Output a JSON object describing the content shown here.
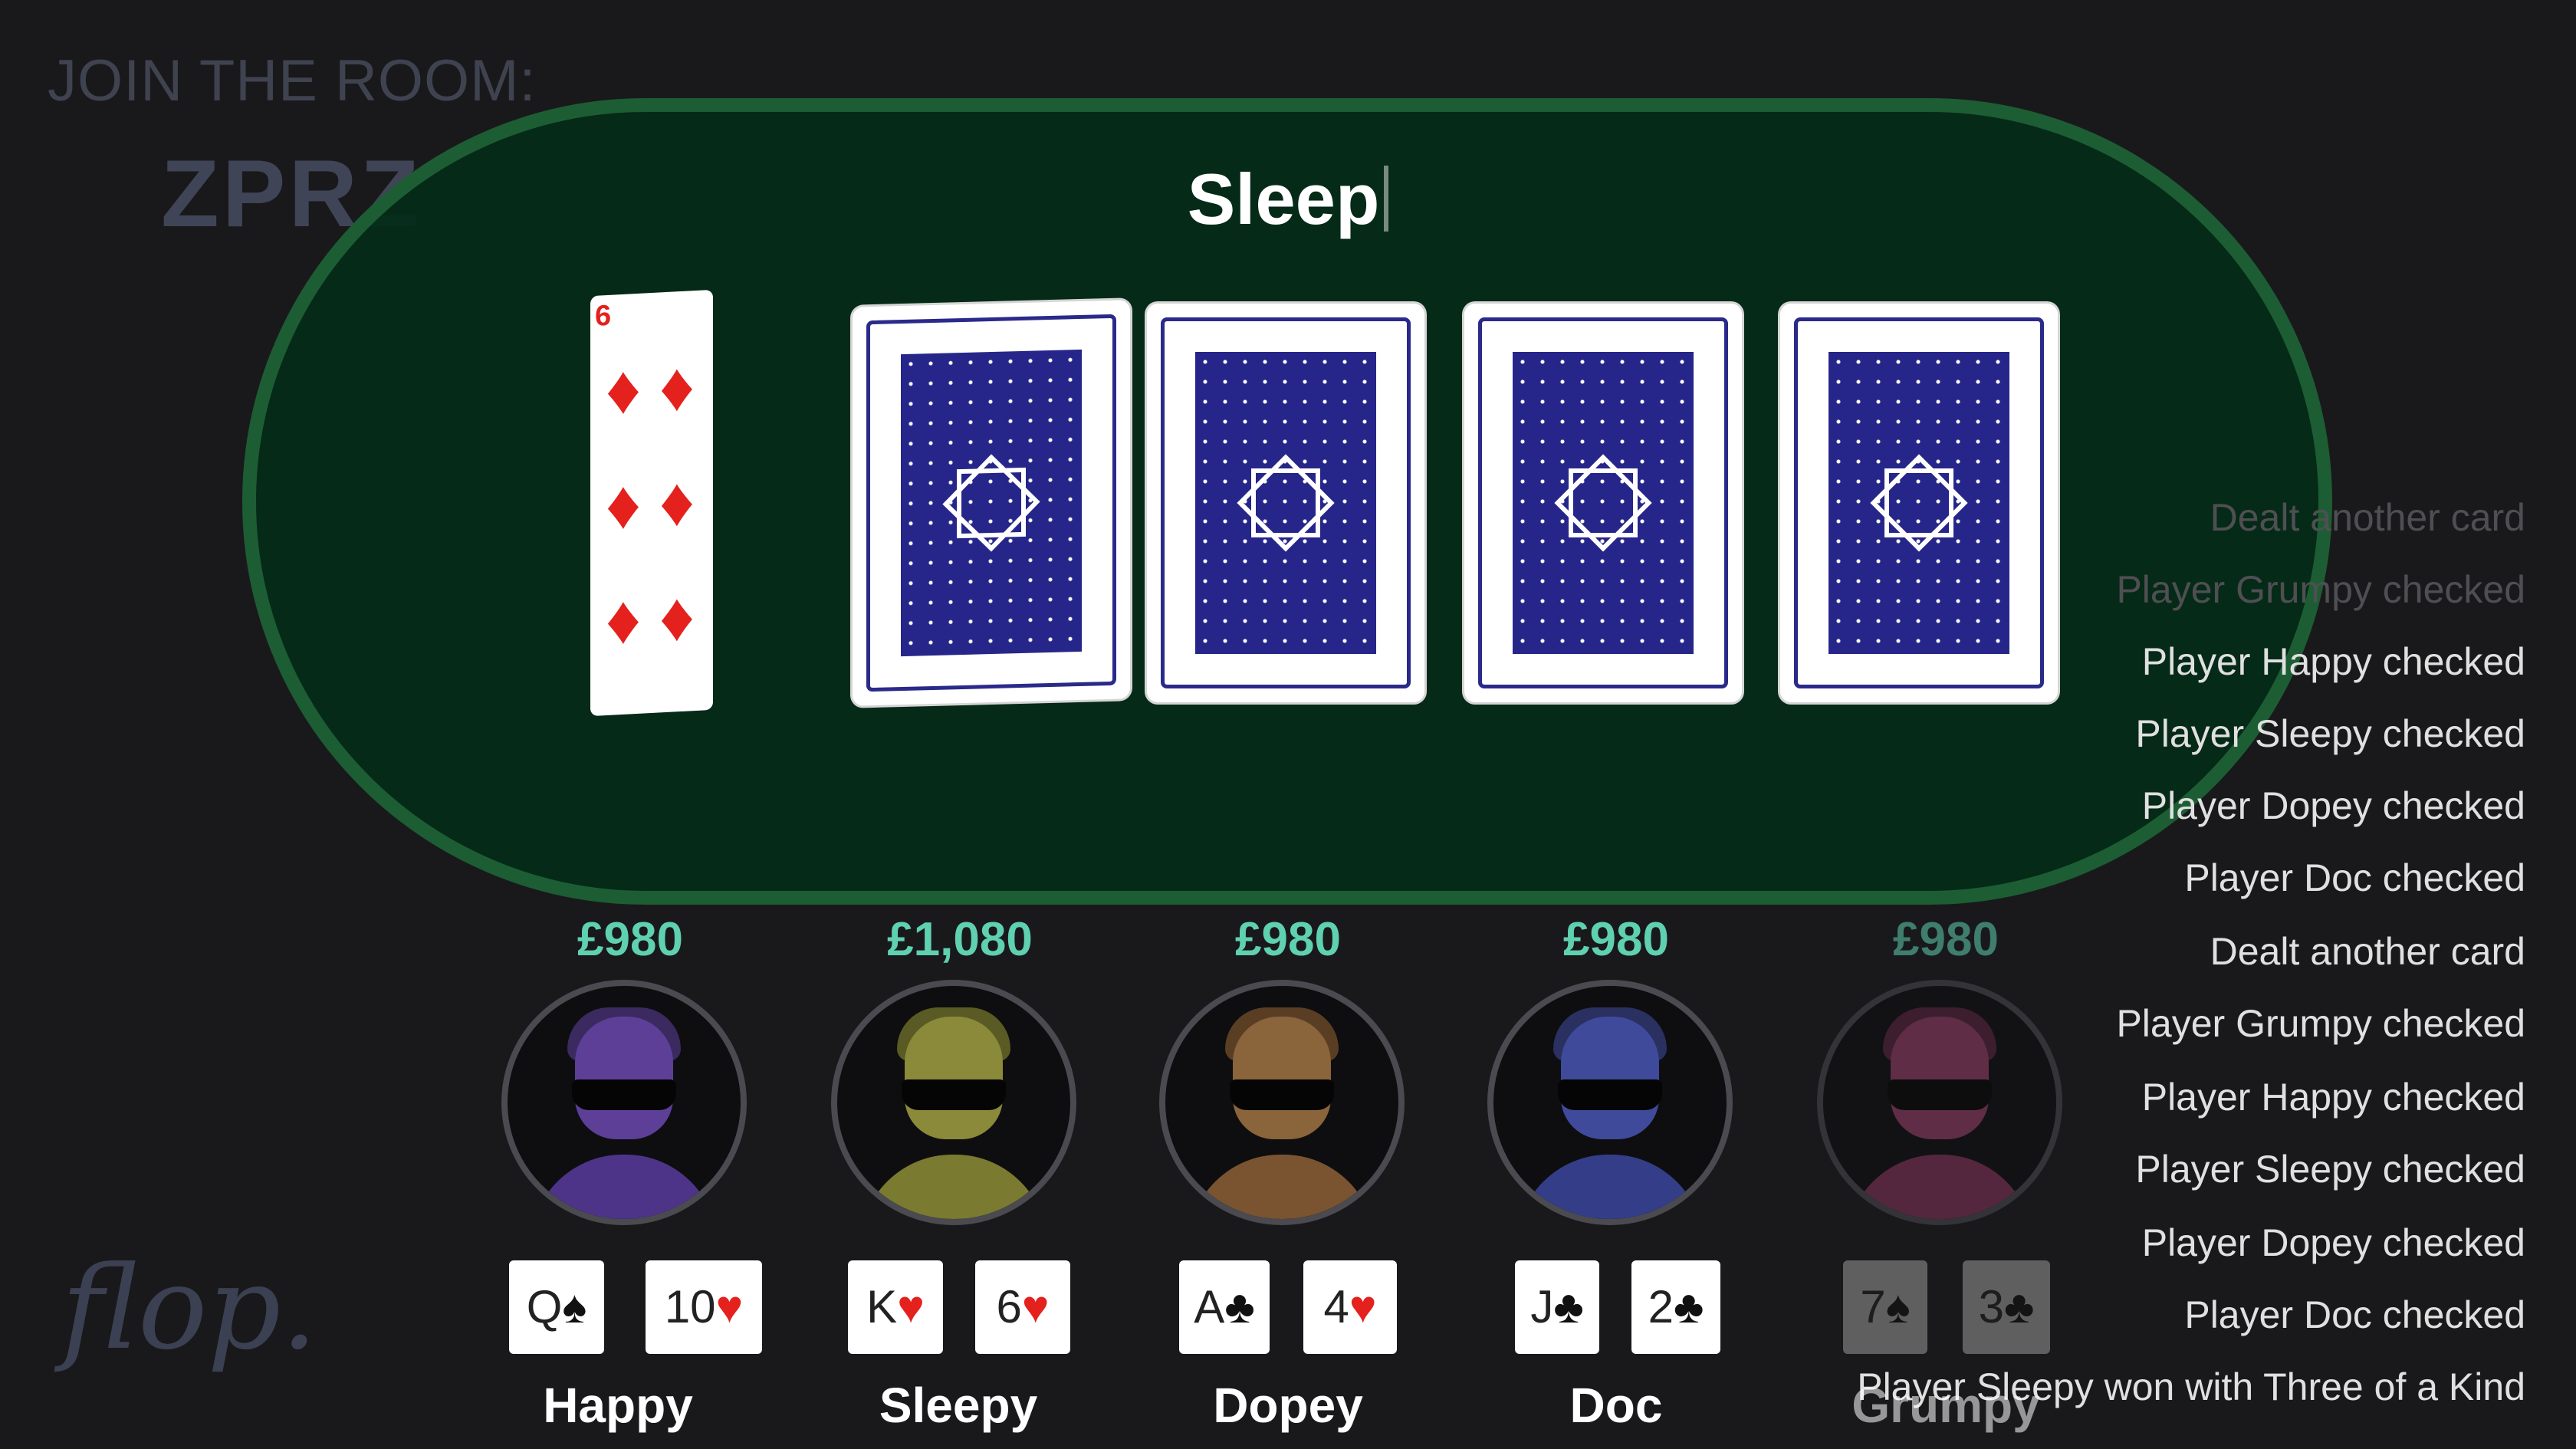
{
  "join": {
    "label": "JOIN THE ROOM:",
    "code": "ZPRZ"
  },
  "headline": "Sleep",
  "board": {
    "flipping_card": {
      "rank": "6",
      "suit": "diamonds"
    },
    "face_down_count": 4
  },
  "log": [
    {
      "text": "Dealt another card",
      "dim": true
    },
    {
      "text": "Player Grumpy checked",
      "dim": true
    },
    {
      "text": "Player Happy checked",
      "dim": false
    },
    {
      "text": "Player Sleepy checked",
      "dim": false
    },
    {
      "text": "Player Dopey checked",
      "dim": false
    },
    {
      "text": "Player Doc checked",
      "dim": false
    },
    {
      "text": "Dealt another card",
      "dim": false
    },
    {
      "text": "Player Grumpy checked",
      "dim": false
    },
    {
      "text": "Player Happy checked",
      "dim": false
    },
    {
      "text": "Player Sleepy checked",
      "dim": false
    },
    {
      "text": "Player Dopey checked",
      "dim": false
    },
    {
      "text": "Player Doc checked",
      "dim": false
    },
    {
      "text": "Player Sleepy won with Three of a Kind",
      "dim": false
    }
  ],
  "players": [
    {
      "name": "Happy",
      "stack": "£980",
      "color": "#5e3f98",
      "cards": [
        {
          "rank": "Q",
          "suit": "♠",
          "red": false
        },
        {
          "rank": "10",
          "suit": "♥",
          "red": true
        }
      ]
    },
    {
      "name": "Sleepy",
      "stack": "£1,080",
      "color": "#9a9a3a",
      "cards": [
        {
          "rank": "K",
          "suit": "♥",
          "red": true
        },
        {
          "rank": "6",
          "suit": "♥",
          "red": true
        }
      ]
    },
    {
      "name": "Dopey",
      "stack": "£980",
      "color": "#9a6a3a",
      "cards": [
        {
          "rank": "A",
          "suit": "♣",
          "red": false
        },
        {
          "rank": "4",
          "suit": "♥",
          "red": true
        }
      ]
    },
    {
      "name": "Doc",
      "stack": "£980",
      "color": "#3f4a9a",
      "cards": [
        {
          "rank": "J",
          "suit": "♣",
          "red": false
        },
        {
          "rank": "2",
          "suit": "♣",
          "red": false
        }
      ]
    },
    {
      "name": "Grumpy",
      "stack": "£980",
      "color": "#9a3f6a",
      "folded": true,
      "cards": [
        {
          "rank": "7",
          "suit": "♠",
          "red": false
        },
        {
          "rank": "3",
          "suit": "♣",
          "red": false
        }
      ]
    }
  ],
  "logo": "flop."
}
